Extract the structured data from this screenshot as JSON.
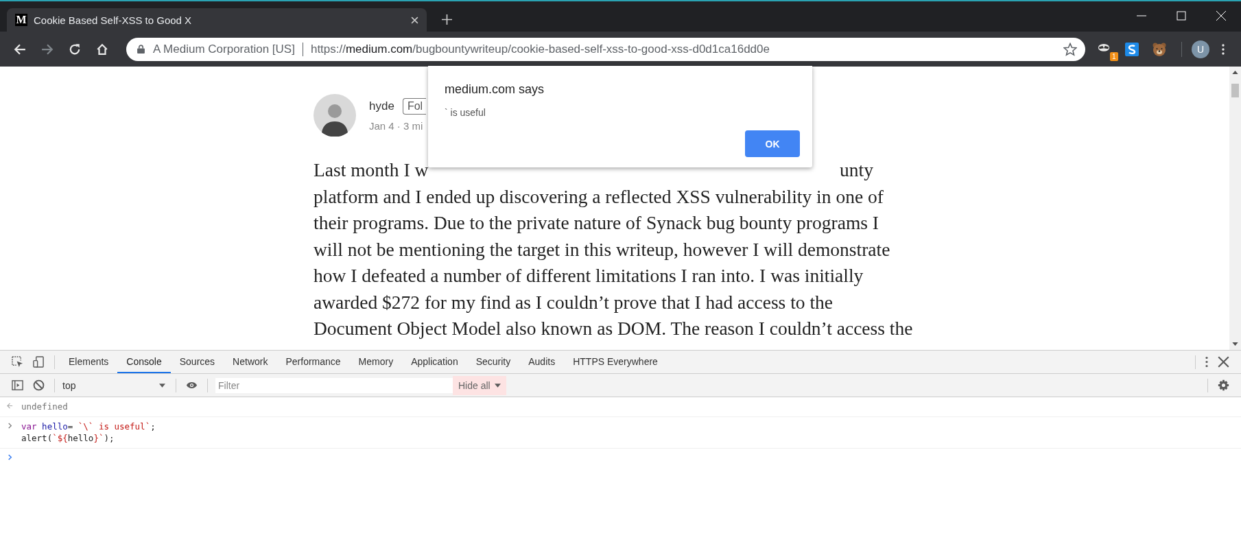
{
  "browser": {
    "tab": {
      "favicon_letter": "M",
      "title": "Cookie Based Self-XSS to Good X"
    },
    "address_bar": {
      "site_identity": "A Medium Corporation [US]",
      "url_scheme": "https://",
      "url_host": "medium.com",
      "url_path": "/bugbountywriteup/cookie-based-self-xss-to-good-xss-d0d1ca16dd0e"
    },
    "extension_badge": "1",
    "profile_initial": "U"
  },
  "article": {
    "author": "hyde",
    "follow_button": "Fol",
    "meta": "Jan 4 · 3 mi",
    "first_line": [
      "Last month I w",
      "unty"
    ],
    "lines": [
      "platform and I ended up discovering a reflected XSS vulnerability in one of",
      "their programs. Due to the private nature of Synack bug bounty programs I",
      "will not be mentioning the target in this writeup, however I will demonstrate",
      "how I defeated a number of different limitations I ran into. I was initially",
      "awarded $272 for my find as I couldn’t prove that I had access to the",
      "Document Object Model also known as DOM. The reason I couldn’t access the"
    ]
  },
  "dialog": {
    "title": "medium.com says",
    "message": "` is useful",
    "button": "OK"
  },
  "devtools": {
    "tabs": [
      {
        "label": "Elements",
        "selected": false
      },
      {
        "label": "Console",
        "selected": true
      },
      {
        "label": "Sources",
        "selected": false
      },
      {
        "label": "Network",
        "selected": false
      },
      {
        "label": "Performance",
        "selected": false
      },
      {
        "label": "Memory",
        "selected": false
      },
      {
        "label": "Application",
        "selected": false
      },
      {
        "label": "Security",
        "selected": false
      },
      {
        "label": "Audits",
        "selected": false
      },
      {
        "label": "HTTPS Everywhere",
        "selected": false
      }
    ],
    "context": "top",
    "filter": {
      "placeholder": "Filter"
    },
    "levels": "Hide all",
    "console": [
      {
        "kind": "result",
        "lines": [
          [
            {
              "kind": "plain",
              "text": "undefined"
            }
          ]
        ]
      },
      {
        "kind": "input",
        "lines": [
          [
            {
              "kind": "keyword",
              "text": "var "
            },
            {
              "kind": "variable",
              "text": "hello"
            },
            {
              "kind": "plain",
              "text": "= "
            },
            {
              "kind": "string",
              "text": "`\\` is useful`"
            },
            {
              "kind": "plain",
              "text": ";"
            }
          ],
          [
            {
              "kind": "plain",
              "text": "alert("
            },
            {
              "kind": "string",
              "text": "`${"
            },
            {
              "kind": "plain",
              "text": "hello"
            },
            {
              "kind": "string",
              "text": "}`"
            },
            {
              "kind": "plain",
              "text": ");"
            }
          ]
        ]
      }
    ]
  }
}
